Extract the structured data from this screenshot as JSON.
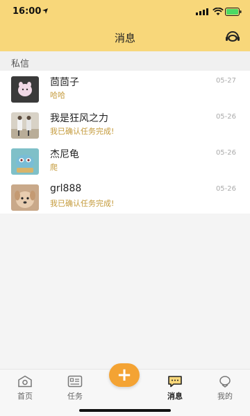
{
  "status_bar": {
    "time": "16:00"
  },
  "header": {
    "title": "消息"
  },
  "section": {
    "label": "私信"
  },
  "messages": [
    {
      "name": "茴茴子",
      "preview": "哈哈",
      "date": "05-27"
    },
    {
      "name": "我是狂风之力",
      "preview": "我已确认任务完成!",
      "date": "05-26"
    },
    {
      "name": "杰尼龟",
      "preview": "爬",
      "date": "05-26"
    },
    {
      "name": "grl888",
      "preview": "我已确认任务完成!",
      "date": "05-26"
    }
  ],
  "tabbar": {
    "tabs": [
      {
        "label": "首页",
        "icon": "home-icon"
      },
      {
        "label": "任务",
        "icon": "task-card-icon"
      },
      {
        "label": "消息",
        "icon": "message-icon",
        "active": true
      },
      {
        "label": "我的",
        "icon": "profile-icon"
      }
    ],
    "fab_label": "+"
  },
  "colors": {
    "header_bg": "#f8d77a",
    "preview_text": "#c49a3a",
    "fab": "#f4a333"
  }
}
